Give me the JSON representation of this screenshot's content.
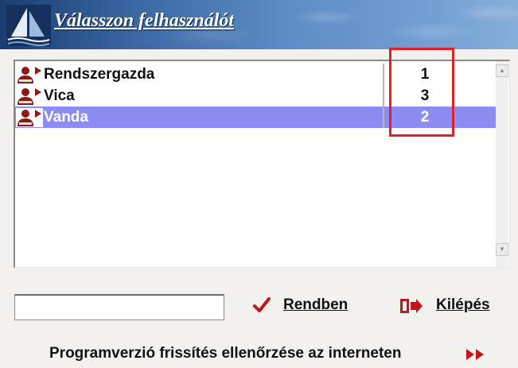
{
  "header": {
    "title": "Válasszon felhasználót",
    "icon": "sailboat-logo-icon"
  },
  "users": [
    {
      "name": "Rendszergazda",
      "number": "1",
      "selected": false,
      "icon": "user-icon"
    },
    {
      "name": "Vica",
      "number": "3",
      "selected": false,
      "icon": "user-icon"
    },
    {
      "name": "Vanda",
      "number": "2",
      "selected": true,
      "icon": "user-icon"
    }
  ],
  "search": {
    "value": "",
    "placeholder": ""
  },
  "buttons": {
    "ok_label": "Rendben",
    "ok_icon": "checkmark-icon",
    "exit_label": "Kilépés",
    "exit_icon": "exit-door-icon"
  },
  "update": {
    "label": "Programverzió frissítés ellenőrzése az interneten",
    "icon": "double-arrow-right-icon"
  },
  "colors": {
    "header_dark": "#1c3d72",
    "header_light": "#86aed9",
    "selection": "#8c8cf2",
    "highlight_box": "#e21f26",
    "icon_red": "#c0161c",
    "user_icon": "#8b1a12"
  }
}
